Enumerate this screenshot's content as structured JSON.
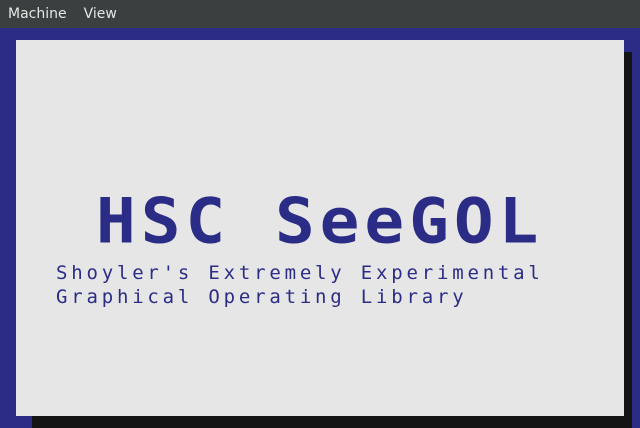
{
  "menubar": {
    "items": [
      "Machine",
      "View"
    ]
  },
  "screen": {
    "title": "HSC SeeGOL",
    "subtitle_line1": "Shoyler's Extremely Experimental",
    "subtitle_line2": "Graphical Operating Library"
  },
  "colors": {
    "border": "#2b2c86",
    "screen_background": "#e6e6e6",
    "text": "#2b2c86",
    "menubar": "#3a3f3f",
    "menubar_text": "#e6e6e6"
  }
}
